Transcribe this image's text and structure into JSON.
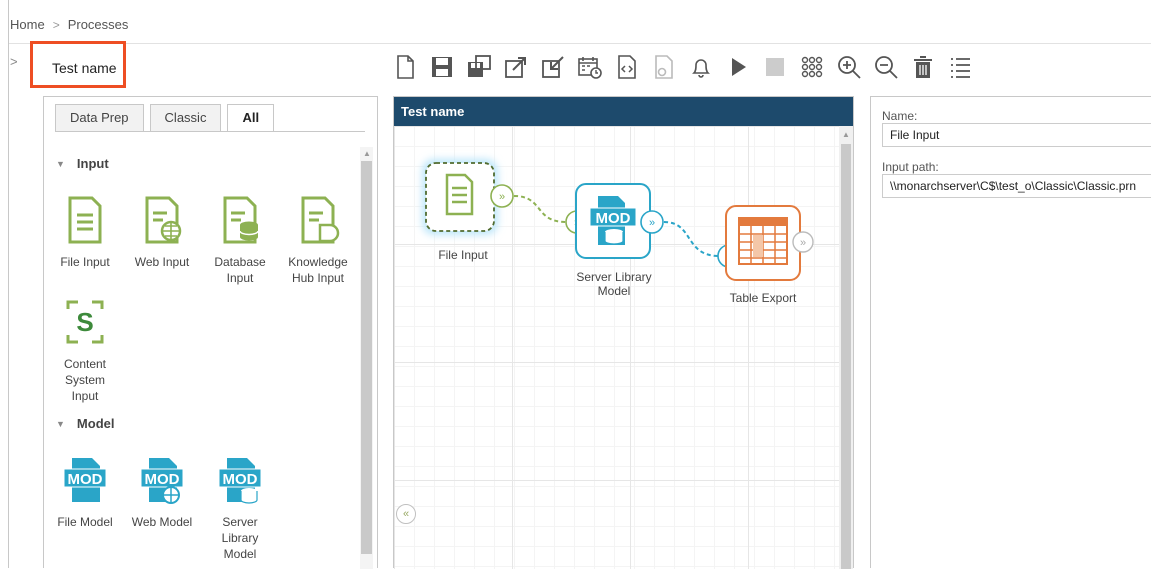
{
  "breadcrumb": {
    "home": "Home",
    "separator": ">",
    "current": "Processes"
  },
  "sidebar_toggle": ">",
  "process": {
    "title": "Test name"
  },
  "toolbar": {
    "icons": [
      "new-document-icon",
      "save-icon",
      "save-as-icon",
      "export-icon",
      "import-icon",
      "schedule-icon",
      "script-icon",
      "settings-document-icon",
      "notification-bell-icon",
      "run-icon",
      "stop-icon",
      "grid-icon",
      "zoom-in-icon",
      "zoom-out-icon",
      "delete-icon",
      "list-icon"
    ]
  },
  "palette": {
    "tabs": [
      {
        "label": "Data Prep",
        "active": false
      },
      {
        "label": "Classic",
        "active": false
      },
      {
        "label": "All",
        "active": true
      }
    ],
    "sections": [
      {
        "title": "Input",
        "items": [
          "File Input",
          "Web Input",
          "Database Input",
          "Knowledge Hub Input",
          "Content System Input"
        ]
      },
      {
        "title": "Model",
        "items": [
          "File Model",
          "Web Model",
          "Server Library Model"
        ]
      }
    ]
  },
  "canvas": {
    "title": "Test name",
    "nodes": [
      {
        "label": "File Input",
        "selected": true
      },
      {
        "label": "Server Library Model",
        "selected": false
      },
      {
        "label": "Table Export",
        "selected": false
      }
    ],
    "minimap_toggle": "«"
  },
  "properties": {
    "name_label": "Name:",
    "name_value": "File Input",
    "path_label": "Input path:",
    "path_value": "\\\\monarchserver\\C$\\test_o\\Classic\\Classic.prn"
  },
  "colors": {
    "accent_header": "#1d4a6c",
    "input_green": "#8db152",
    "model_teal": "#2aa5c8",
    "export_orange": "#e37a3d",
    "highlight_red": "#ee4e23"
  }
}
